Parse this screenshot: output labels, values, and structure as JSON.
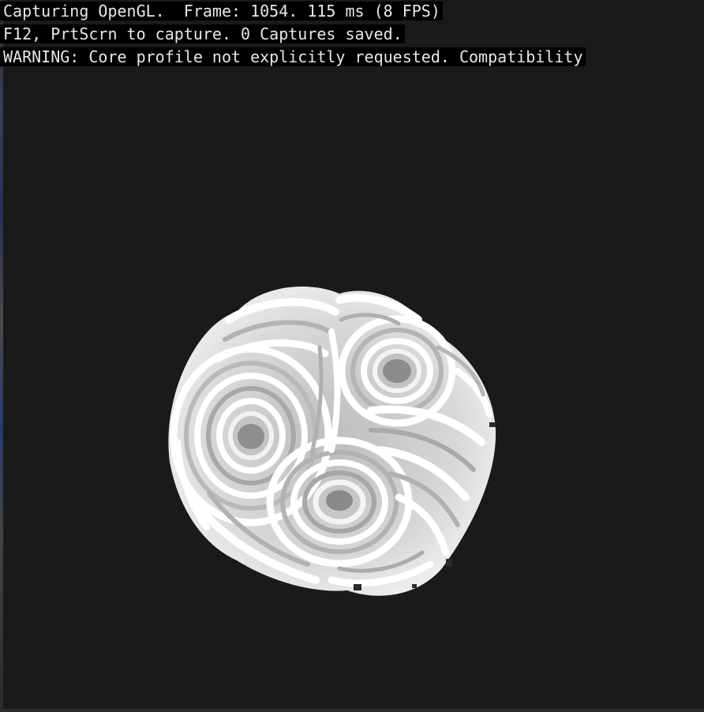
{
  "overlay": {
    "line1": "Capturing OpenGL.  Frame: 1054. 115 ms (8 FPS)",
    "line2": "F12, PrtScrn to capture. 0 Captures saved.",
    "line3": "WARNING: Core profile not explicitly requested. Compatibility"
  },
  "colors": {
    "background": "#1a1a1a",
    "overlay_bg": "#000000",
    "overlay_text": "#e8e8e8",
    "blob_light": "#f4f4f4",
    "blob_shade": "#8a8a8a"
  }
}
